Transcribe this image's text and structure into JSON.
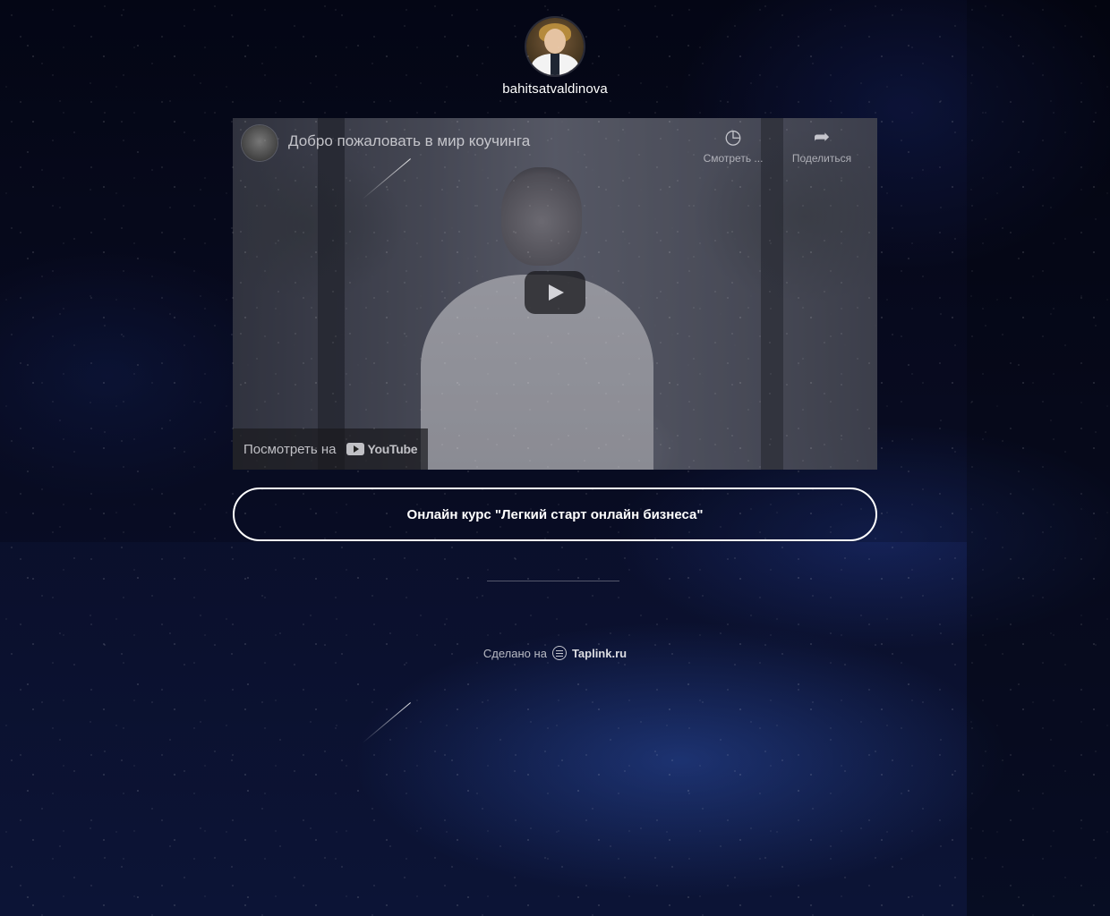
{
  "profile": {
    "username": "bahitsatvaldinova"
  },
  "video": {
    "title": "Добро пожаловать в мир коучинга",
    "watch_later_label": "Смотреть ...",
    "share_label": "Поделиться",
    "watch_on_label": "Посмотреть на",
    "platform_label": "YouTube"
  },
  "course_button": {
    "label": "Онлайн курс \"Легкий старт онлайн бизнеса\""
  },
  "footer": {
    "made_on_label": "Сделано на",
    "brand_label": "Taplink.ru"
  },
  "icons": {
    "clock": "clock-icon",
    "share": "share-icon",
    "play": "play-icon",
    "youtube": "youtube-logo-icon",
    "taplink": "taplink-icon"
  },
  "colors": {
    "background": "#06081a",
    "text": "#ffffff",
    "button_border": "#ffffff"
  }
}
